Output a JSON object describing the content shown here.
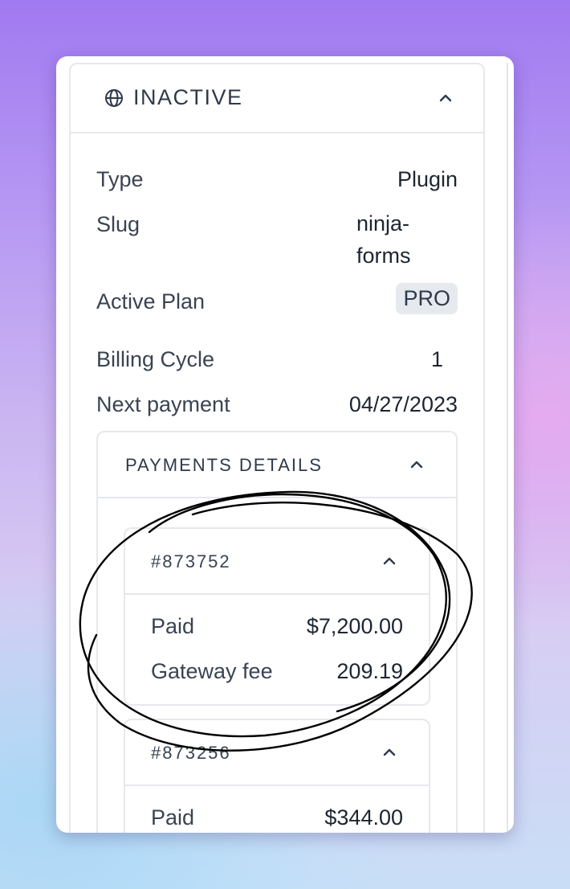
{
  "panel": {
    "title": "INACTIVE",
    "icon": "globe-icon",
    "rows": {
      "type_label": "Type",
      "type_value": "Plugin",
      "slug_label": "Slug",
      "slug_value_line1": "ninja-",
      "slug_value_line2": "forms",
      "plan_label": "Active Plan",
      "plan_value": "PRO",
      "cycle_label": "Billing Cycle",
      "cycle_value": "1",
      "next_label": "Next payment",
      "next_value": "04/27/2023"
    }
  },
  "payments": {
    "title": "PAYMENTS DETAILS",
    "invoices": [
      {
        "id": "#873752",
        "paid_label": "Paid",
        "paid_value": "$7,200.00",
        "fee_label": "Gateway fee",
        "fee_value": "209.19"
      },
      {
        "id": "#873256",
        "paid_label": "Paid",
        "paid_value": "$344.00"
      }
    ]
  },
  "colors": {
    "text_primary": "#1e2530",
    "text_secondary": "#3a4352",
    "border": "#e6e8ec",
    "badge_bg": "#e6e9ee",
    "annotation": "#000000"
  }
}
